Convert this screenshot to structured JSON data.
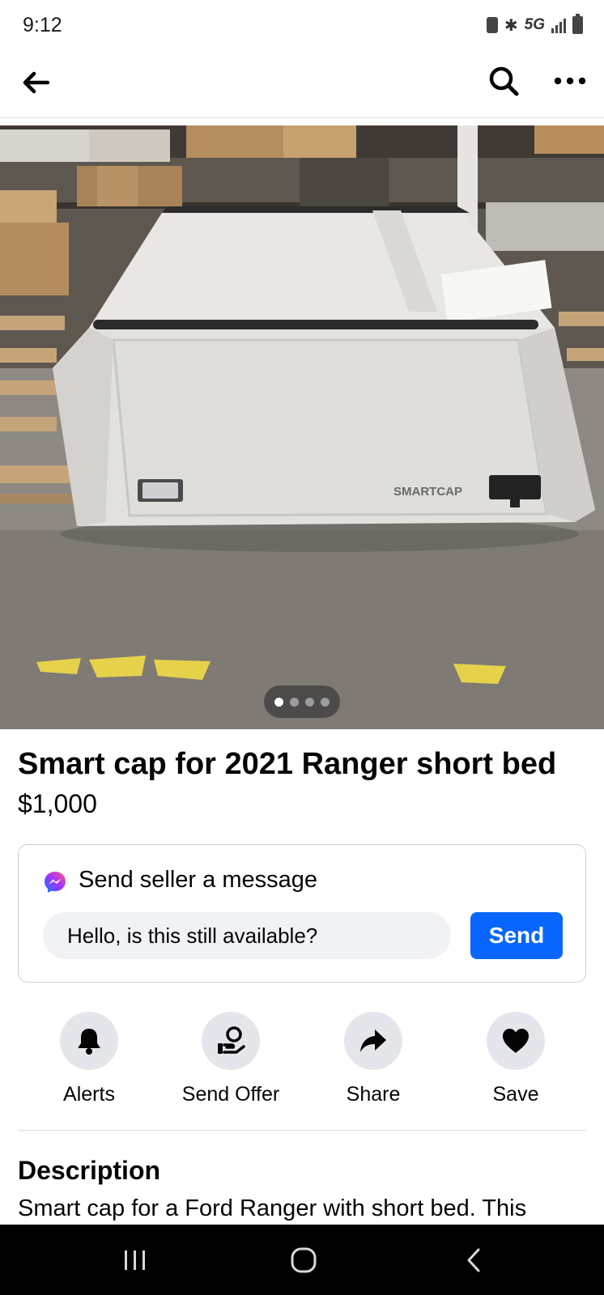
{
  "status_bar": {
    "time": "9:12",
    "network": "5G"
  },
  "listing": {
    "title": "Smart cap for 2021 Ranger short bed",
    "price": "$1,000",
    "photo": {
      "brand_text": "SMARTCAP",
      "current_index": 1,
      "total": 4
    }
  },
  "message_card": {
    "heading": "Send seller a message",
    "input_value": "Hello, is this still available?",
    "send_label": "Send"
  },
  "actions": [
    {
      "label": "Alerts",
      "icon": "bell-icon"
    },
    {
      "label": "Send Offer",
      "icon": "offer-icon"
    },
    {
      "label": "Share",
      "icon": "share-icon"
    },
    {
      "label": "Save",
      "icon": "heart-icon"
    }
  ],
  "description": {
    "heading": "Description",
    "text": "Smart cap for a Ford Ranger with short bed. This"
  },
  "colors": {
    "accent": "#0866ff",
    "icon_circle": "#e4e6eb"
  }
}
